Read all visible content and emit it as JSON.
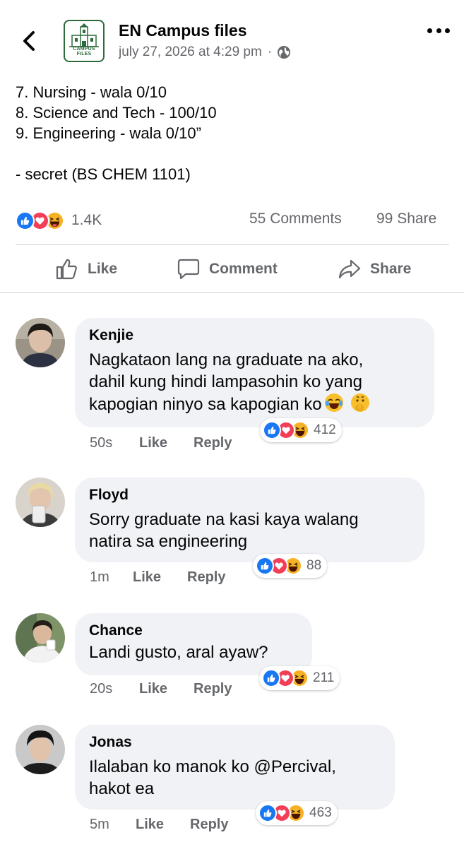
{
  "header": {
    "page_name": "EN Campus files",
    "logo_text": "CAMPUS FILES",
    "timestamp": "july 27, 2026 at 4:29 pm",
    "separator": "·",
    "audience_icon": "globe-icon",
    "back_icon": "chevron-left-icon",
    "more_icon": "more-horizontal-icon"
  },
  "post": {
    "lines": [
      "7. Nursing - wala 0/10",
      "8. Science and Tech - 100/10",
      "9. Engineering - wala 0/10”",
      "",
      "- secret (BS CHEM 1101)"
    ]
  },
  "stats": {
    "reactions": "1.4K",
    "comments": "55 Comments",
    "shares": "99 Share",
    "reaction_types": [
      "like",
      "love",
      "haha"
    ]
  },
  "actions": {
    "like": "Like",
    "comment": "Comment",
    "share": "Share"
  },
  "colors": {
    "like_blue": "#1877f2",
    "love_red": "#f33e58",
    "haha_yellow": "#f7b125",
    "bubble_bg": "#f0f2f5",
    "meta_gray": "#65676b",
    "logo_green": "#2e6b3c"
  },
  "comments": [
    {
      "author": "Kenjie",
      "lines": [
        "Nagkataon lang na graduate na ako,",
        "dahil kung hindi lampasohin ko yang",
        "kapogian ninyo sa kapogian ko"
      ],
      "emojis": [
        "joy-emoji",
        "shushing-face-emoji"
      ],
      "reactions": "412",
      "time": "50s",
      "like": "Like",
      "reply": "Reply"
    },
    {
      "author": "Floyd",
      "lines": [
        "Sorry graduate na kasi kaya walang",
        "natira sa engineering"
      ],
      "emojis": [],
      "reactions": "88",
      "time": "1m",
      "like": "Like",
      "reply": "Reply"
    },
    {
      "author": "Chance",
      "lines": [
        "Landi gusto, aral ayaw?"
      ],
      "emojis": [],
      "reactions": "211",
      "time": "20s",
      "like": "Like",
      "reply": "Reply"
    },
    {
      "author": "Jonas",
      "lines": [
        "Ilalaban ko manok ko @Percival,",
        "hakot ea"
      ],
      "emojis": [],
      "reactions": "463",
      "time": "5m",
      "like": "Like",
      "reply": "Reply"
    }
  ]
}
